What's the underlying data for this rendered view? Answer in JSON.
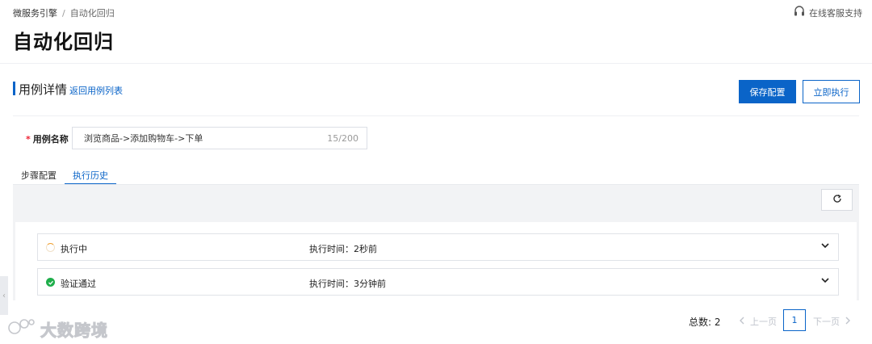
{
  "breadcrumb": {
    "items": [
      "微服务引擎",
      "自动化回归"
    ],
    "separator": "/"
  },
  "support": {
    "label": "在线客服支持",
    "icon": "headset-icon"
  },
  "page": {
    "title": "自动化回归"
  },
  "section": {
    "title": "用例详情",
    "back_link": "返回用例列表",
    "save_button": "保存配置",
    "run_button": "立即执行"
  },
  "form": {
    "case_name": {
      "required_mark": "*",
      "label": "用例名称",
      "value": "浏览商品->添加购物车->下单",
      "counter": "15/200"
    }
  },
  "tabs": [
    {
      "label": "步骤配置",
      "active": false
    },
    {
      "label": "执行历史",
      "active": true
    }
  ],
  "history": {
    "refresh_icon": "refresh-icon",
    "rows": [
      {
        "status": "执行中",
        "status_icon": "spinner-icon",
        "time": "执行时间：2秒前"
      },
      {
        "status": "验证通过",
        "status_icon": "check-circle-icon",
        "time": "执行时间：3分钟前"
      }
    ]
  },
  "pagination": {
    "total_label": "总数: 2",
    "prev_label": "上一页",
    "current_page": "1",
    "next_label": "下一页"
  },
  "watermark": {
    "text": "大数跨境"
  },
  "colors": {
    "primary": "#0a64c8",
    "success": "#1fae4b",
    "running": "#f0a030",
    "required": "#e22233"
  }
}
